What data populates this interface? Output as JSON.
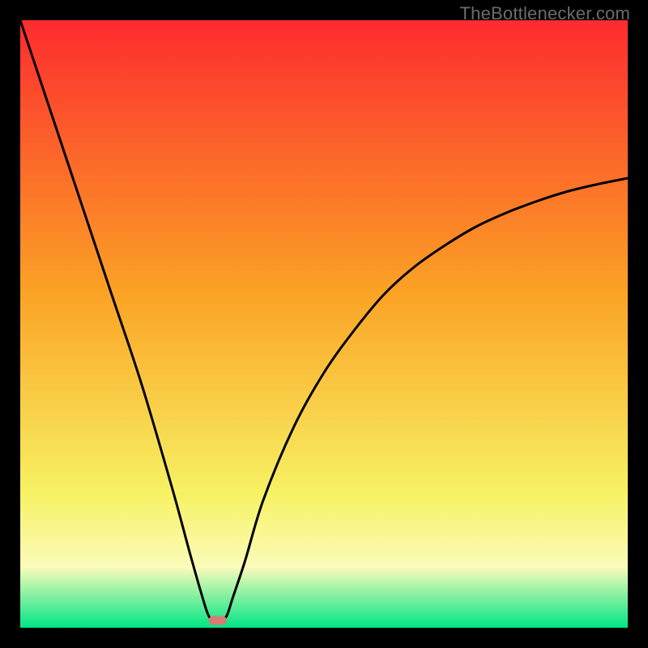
{
  "watermark": "TheBottlenecker.com",
  "colors": {
    "black": "#000000",
    "red_top": "#fd2b2f",
    "orange_mid": "#fba325",
    "yellow_low": "#f7f264",
    "pale_yellow": "#fbfbba",
    "green_bottom": "#00e585",
    "curve": "#000000",
    "marker": "#d87b76",
    "watermark_text": "#6b6b6b"
  },
  "chart_data": {
    "type": "line",
    "title": "",
    "xlabel": "",
    "ylabel": "",
    "xlim": [
      0,
      100
    ],
    "ylim": [
      0,
      100
    ],
    "series": [
      {
        "name": "bottleneck-curve",
        "x": [
          0,
          5,
          10,
          15,
          20,
          25,
          28,
          30,
          31,
          32,
          33,
          34,
          35,
          37,
          40,
          45,
          50,
          55,
          60,
          65,
          70,
          75,
          80,
          85,
          90,
          95,
          100
        ],
        "values": [
          100,
          85,
          70,
          55,
          40,
          23,
          12,
          5,
          2,
          1,
          1,
          2,
          5,
          11,
          21,
          33,
          42,
          49,
          55,
          59.5,
          63,
          66,
          68.3,
          70.2,
          71.8,
          73,
          74
        ]
      }
    ],
    "vertex_x": 32.5,
    "marker": {
      "x": 32.5,
      "y": 1.2
    }
  }
}
